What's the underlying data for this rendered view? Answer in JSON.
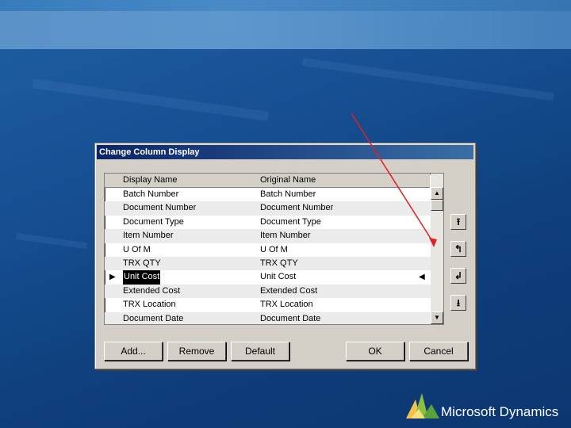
{
  "dialog": {
    "title": "Change Column Display",
    "columns": [
      "Display Name",
      "Original Name"
    ],
    "rows": [
      {
        "display": "Batch Number",
        "original": "Batch Number"
      },
      {
        "display": "Document Number",
        "original": "Document Number"
      },
      {
        "display": "Document Type",
        "original": "Document Type"
      },
      {
        "display": "Item Number",
        "original": "Item Number"
      },
      {
        "display": "U Of M",
        "original": "U Of M"
      },
      {
        "display": "TRX QTY",
        "original": "TRX QTY"
      },
      {
        "display": "Unit Cost",
        "original": "Unit Cost",
        "selected": true
      },
      {
        "display": "Extended Cost",
        "original": "Extended Cost"
      },
      {
        "display": "TRX Location",
        "original": "TRX Location"
      },
      {
        "display": "Document Date",
        "original": "Document Date"
      }
    ],
    "buttons": {
      "add": "Add...",
      "remove": "Remove",
      "default": "Default",
      "ok": "OK",
      "cancel": "Cancel"
    },
    "side_buttons": [
      "move-top-icon",
      "move-up-icon",
      "move-down-icon",
      "move-bottom-icon"
    ]
  },
  "annotation": {
    "color": "#e02020"
  },
  "branding": {
    "logo_text": "Microsoft Dynamics"
  }
}
